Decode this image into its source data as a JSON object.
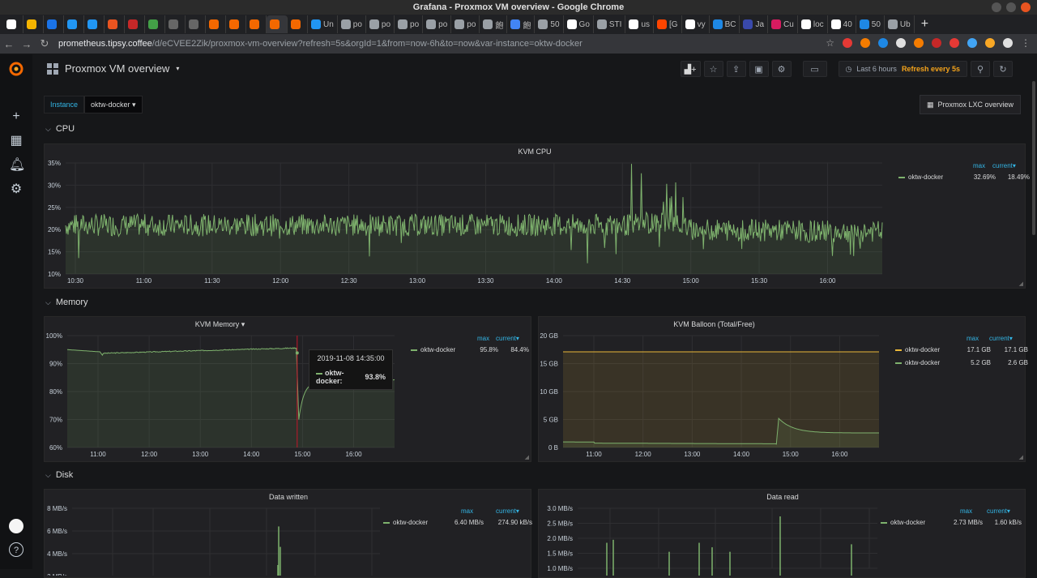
{
  "window": {
    "title": "Grafana - Proxmox VM overview - Google Chrome"
  },
  "tabs": [
    {
      "icon": "google-icon",
      "color": "#ffffff",
      "label": ""
    },
    {
      "icon": "drive-icon",
      "color": "#f4b400",
      "label": ""
    },
    {
      "icon": "ovh-icon",
      "color": "#1a73e8",
      "label": ""
    },
    {
      "icon": "ionos-icon",
      "color": "#2196f3",
      "label": ""
    },
    {
      "icon": "ionos-icon",
      "color": "#2196f3",
      "label": ""
    },
    {
      "icon": "x-icon",
      "color": "#e95420",
      "label": ""
    },
    {
      "icon": "notification-icon",
      "color": "#c62828",
      "label": ""
    },
    {
      "icon": "circle-icon",
      "color": "#43a047",
      "label": ""
    },
    {
      "icon": "globe-icon",
      "color": "#666666",
      "label": ""
    },
    {
      "icon": "globe-icon",
      "color": "#666666",
      "label": ""
    },
    {
      "icon": "grafana-icon",
      "color": "#f46800",
      "label": ""
    },
    {
      "icon": "grafana-icon",
      "color": "#f46800",
      "label": ""
    },
    {
      "icon": "grafana-icon",
      "color": "#f46800",
      "label": ""
    },
    {
      "icon": "grafana-icon",
      "color": "#f46800",
      "label": "",
      "active": true
    },
    {
      "icon": "grafana-icon",
      "color": "#f46800",
      "label": ""
    },
    {
      "icon": "ionos-icon",
      "color": "#2196f3",
      "label": "Un"
    },
    {
      "icon": "clock-icon",
      "color": "#9aa0a6",
      "label": "po"
    },
    {
      "icon": "clock-icon",
      "color": "#9aa0a6",
      "label": "po"
    },
    {
      "icon": "clock-icon",
      "color": "#9aa0a6",
      "label": "po"
    },
    {
      "icon": "clock-icon",
      "color": "#9aa0a6",
      "label": "po"
    },
    {
      "icon": "clock-icon",
      "color": "#9aa0a6",
      "label": "po"
    },
    {
      "icon": "globe-icon",
      "color": "#9aa0a6",
      "label": "飽"
    },
    {
      "icon": "calendar-icon",
      "color": "#4285f4",
      "label": "飽"
    },
    {
      "icon": "globe-icon",
      "color": "#9aa0a6",
      "label": "50"
    },
    {
      "icon": "google-icon",
      "color": "#ffffff",
      "label": "Go"
    },
    {
      "icon": "grid-icon",
      "color": "#9aa0a6",
      "label": "STI"
    },
    {
      "icon": "google-icon",
      "color": "#ffffff",
      "label": "us"
    },
    {
      "icon": "reddit-icon",
      "color": "#ff4500",
      "label": "[G"
    },
    {
      "icon": "google-icon",
      "color": "#ffffff",
      "label": "vy"
    },
    {
      "icon": "x-icon",
      "color": "#1e88e5",
      "label": "BC"
    },
    {
      "icon": "j-icon",
      "color": "#3949ab",
      "label": "Ja"
    },
    {
      "icon": "h-icon",
      "color": "#d81b60",
      "label": "Cu"
    },
    {
      "icon": "doc-icon",
      "color": "#ffffff",
      "label": "loc"
    },
    {
      "icon": "google-icon",
      "color": "#ffffff",
      "label": "40"
    },
    {
      "icon": "c-icon",
      "color": "#1e88e5",
      "label": "50"
    },
    {
      "icon": "globe-icon",
      "color": "#9aa0a6",
      "label": "Ub"
    }
  ],
  "browser": {
    "url_host": "prometheus.tipsy.coffee",
    "url_path": "/d/eCVEE2Zik/proxmox-vm-overview?refresh=5s&orgId=1&from=now-6h&to=now&var-instance=oktw-docker"
  },
  "dashboard": {
    "title": "Proxmox VM overview",
    "time_range": "Last 6 hours",
    "refresh": "Refresh every 5s",
    "variable_label": "Instance",
    "variable_value": "oktw-docker",
    "lxc_link": "Proxmox LXC overview"
  },
  "rows": {
    "cpu": "CPU",
    "memory": "Memory",
    "disk": "Disk"
  },
  "panels": {
    "kvm_cpu": {
      "title": "KVM CPU",
      "legend_max_label": "max",
      "legend_current_label": "current▾",
      "series_name": "oktw-docker",
      "max": "32.69%",
      "current": "18.49%",
      "y_ticks": [
        "35%",
        "30%",
        "25%",
        "20%",
        "15%",
        "10%"
      ],
      "x_ticks": [
        "10:30",
        "11:00",
        "11:30",
        "12:00",
        "12:30",
        "13:00",
        "13:30",
        "14:00",
        "14:30",
        "15:00",
        "15:30",
        "16:00"
      ]
    },
    "kvm_memory": {
      "title": "KVM Memory ▾",
      "legend_max_label": "max",
      "legend_current_label": "current▾",
      "series_name": "oktw-docker",
      "max": "95.8%",
      "current": "84.4%",
      "y_ticks": [
        "100%",
        "90%",
        "80%",
        "70%",
        "60%"
      ],
      "x_ticks": [
        "11:00",
        "12:00",
        "13:00",
        "14:00",
        "15:00",
        "16:00"
      ],
      "tooltip_time": "2019-11-08 14:35:00",
      "tooltip_series": "oktw-docker:",
      "tooltip_value": "93.8%"
    },
    "kvm_balloon": {
      "title": "KVM Balloon (Total/Free)",
      "legend_max_label": "max",
      "legend_current_label": "current▾",
      "series": [
        {
          "name": "oktw-docker",
          "max": "17.1 GB",
          "current": "17.1 GB",
          "color": "#eab839"
        },
        {
          "name": "oktw-docker",
          "max": "5.2 GB",
          "current": "2.6 GB",
          "color": "#7eb26d"
        }
      ],
      "y_ticks": [
        "20 GB",
        "15 GB",
        "10 GB",
        "5 GB",
        "0 B"
      ],
      "x_ticks": [
        "11:00",
        "12:00",
        "13:00",
        "14:00",
        "15:00",
        "16:00"
      ]
    },
    "data_written": {
      "title": "Data written",
      "legend_max_label": "max",
      "legend_current_label": "current▾",
      "series_name": "oktw-docker",
      "max": "6.40 MB/s",
      "current": "274.90 kB/s",
      "y_ticks": [
        "8 MB/s",
        "6 MB/s",
        "4 MB/s"
      ]
    },
    "data_read": {
      "title": "Data read",
      "legend_max_label": "max",
      "legend_current_label": "current▾",
      "series_name": "oktw-docker",
      "max": "2.73 MB/s",
      "current": "1.60 kB/s",
      "y_ticks": [
        "3.0 MB/s",
        "2.5 MB/s",
        "2.0 MB/s",
        "1.5 MB/s",
        "1.0 MB/s"
      ]
    }
  },
  "colors": {
    "series_green": "#7eb26d",
    "series_yellow": "#eab839",
    "accent_blue": "#33b5e5",
    "refresh_orange": "#f4a31b"
  },
  "chart_data": [
    {
      "type": "line",
      "title": "KVM CPU",
      "ylim": [
        10,
        35
      ],
      "series": [
        {
          "name": "oktw-docker",
          "max": 32.69,
          "current": 18.49
        }
      ]
    },
    {
      "type": "line",
      "title": "KVM Memory",
      "ylim": [
        60,
        100
      ],
      "series": [
        {
          "name": "oktw-docker",
          "max": 95.8,
          "current": 84.4
        }
      ]
    },
    {
      "type": "line",
      "title": "KVM Balloon (Total/Free)",
      "ylim": [
        0,
        20
      ],
      "series": [
        {
          "name": "oktw-docker",
          "max": 17.1,
          "current": 17.1
        },
        {
          "name": "oktw-docker",
          "max": 5.2,
          "current": 2.6
        }
      ]
    },
    {
      "type": "line",
      "title": "Data written",
      "series": [
        {
          "name": "oktw-docker",
          "max": 6.4,
          "current": 0.2749
        }
      ]
    },
    {
      "type": "line",
      "title": "Data read",
      "series": [
        {
          "name": "oktw-docker",
          "max": 2.73,
          "current": 0.0016
        }
      ]
    }
  ]
}
